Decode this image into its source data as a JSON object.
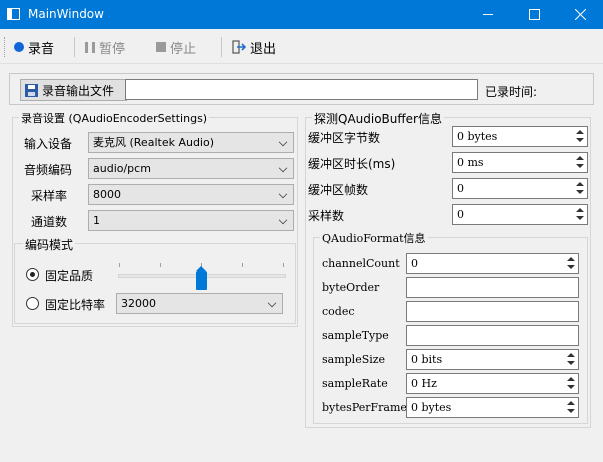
{
  "window": {
    "title": "MainWindow"
  },
  "toolbar": {
    "record_label": "录音",
    "pause_label": "暂停",
    "stop_label": "停止",
    "exit_label": "退出"
  },
  "output": {
    "button_label": "录音输出文件",
    "path_value": "",
    "elapsed_label": "已录时间:"
  },
  "encoder": {
    "group_title": "录音设置 (QAudioEncoderSettings)",
    "input_device_label": "输入设备",
    "input_device_value": "麦克风 (Realtek Audio)",
    "codec_label": "音频编码",
    "codec_value": "audio/pcm",
    "sample_rate_label": "采样率",
    "sample_rate_value": "8000",
    "channels_label": "通道数",
    "channels_value": "1",
    "mode_group_title": "编码模式",
    "quality_label": "固定品质",
    "quality_level": 0.5,
    "bitrate_label": "固定比特率",
    "bitrate_value": "32000"
  },
  "buffer": {
    "group_title": "探测QAudioBuffer信息",
    "byte_count_label": "缓冲区字节数",
    "byte_count_value": "0  bytes",
    "duration_label": "缓冲区时长(ms)",
    "duration_value": "0  ms",
    "frame_count_label": "缓冲区帧数",
    "frame_count_value": "0",
    "sample_count_label": "采样数",
    "sample_count_value": "0"
  },
  "format": {
    "group_title": "QAudioFormat信息",
    "channel_count_label": "channelCount",
    "channel_count_value": "0",
    "byte_order_label": "byteOrder",
    "byte_order_value": "",
    "codec_label": "codec",
    "codec_value": "",
    "sample_type_label": "sampleType",
    "sample_type_value": "",
    "sample_size_label": "sampleSize",
    "sample_size_value": "0  bits",
    "sample_rate_label": "sampleRate",
    "sample_rate_value": "0  Hz",
    "bytes_per_frame_label": "bytesPerFrame",
    "bytes_per_frame_value": "0  bytes"
  },
  "colors": {
    "titlebar": "#0078d7",
    "record_icon": "#1166d8",
    "slider": "#0078d7"
  }
}
